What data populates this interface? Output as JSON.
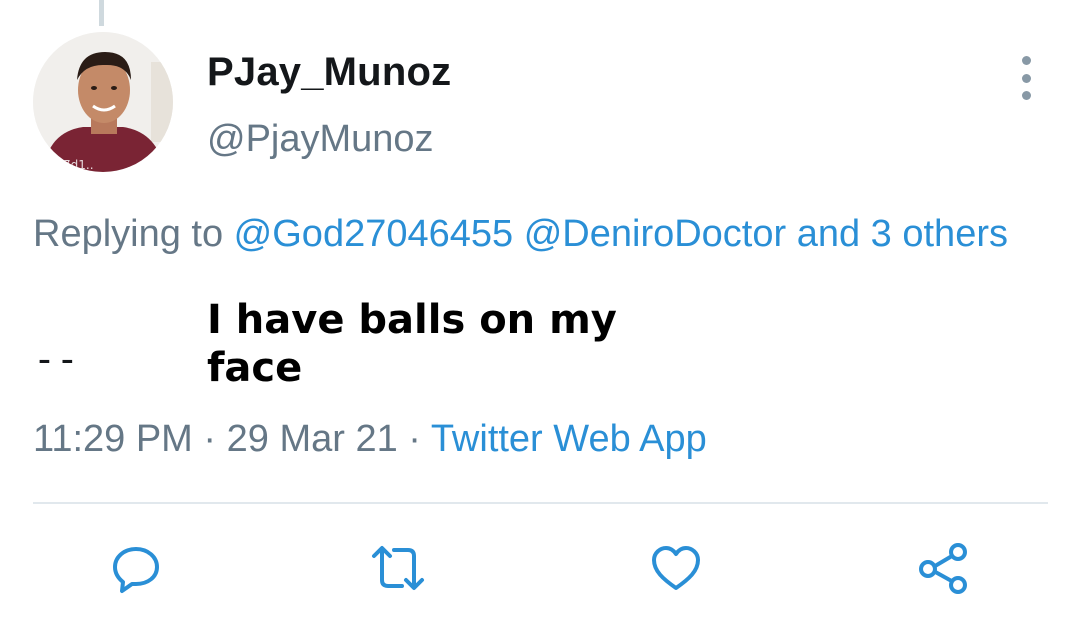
{
  "tweet": {
    "display_name": "PJay_Munoz",
    "handle": "@PjayMunoz",
    "replying_prefix": "Replying to ",
    "replying_users": [
      "@God27046455",
      "@DeniroDoctor"
    ],
    "replying_and": " and 3 others",
    "prefix_text": "--",
    "text_line1": "I have balls on my",
    "text_line2": "face",
    "time": "11:29 PM",
    "separator": " · ",
    "date": "29 Mar 21",
    "source": "Twitter Web App"
  },
  "colors": {
    "link": "#2a8fd6",
    "secondary_text": "#657786",
    "icon": "#2a8fd6",
    "divider": "#e1e8ed"
  },
  "actions": [
    {
      "name": "reply",
      "icon": "speech-bubble-icon"
    },
    {
      "name": "retweet",
      "icon": "retweet-icon"
    },
    {
      "name": "like",
      "icon": "heart-icon"
    },
    {
      "name": "share",
      "icon": "share-icon"
    }
  ]
}
